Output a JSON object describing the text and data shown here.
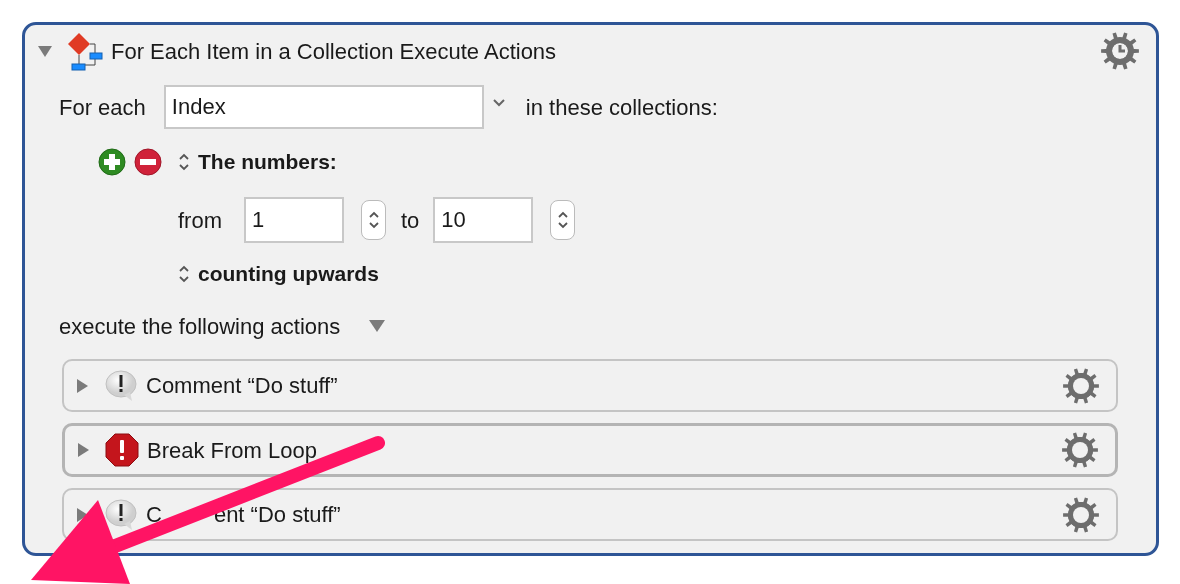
{
  "action": {
    "title": "For Each Item in a Collection Execute Actions",
    "expanded": true
  },
  "for_each": {
    "label": "For each",
    "variable": "Index",
    "suffix": "in these collections:"
  },
  "collection": {
    "title": "The numbers:",
    "from_label": "from",
    "from_value": "1",
    "to_label": "to",
    "to_value": "10",
    "direction": "counting upwards"
  },
  "execute_label": "execute the following actions",
  "actions": [
    {
      "title": "Comment “Do stuff”",
      "kind": "comment",
      "expanded": false,
      "selected": false
    },
    {
      "title": "Break From Loop",
      "kind": "break",
      "expanded": false,
      "selected": true
    },
    {
      "title_fragments": [
        "C",
        "ent “Do stuff”"
      ],
      "kind": "comment",
      "expanded": false,
      "selected": false
    }
  ]
}
